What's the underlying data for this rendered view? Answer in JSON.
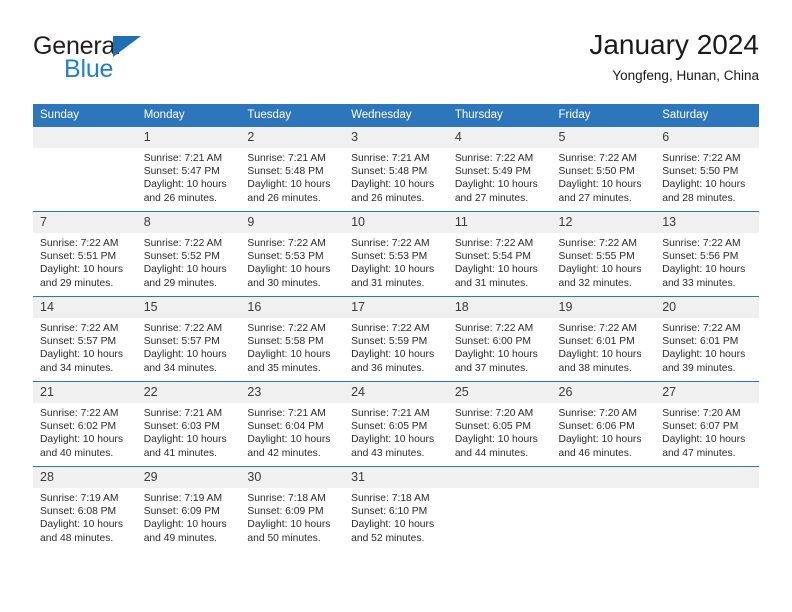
{
  "brand": {
    "name_top": "General",
    "name_bottom": "Blue",
    "triangle_color": "#1f6fb5",
    "blue_color": "#1f7fd0"
  },
  "header": {
    "title": "January 2024",
    "subtitle": "Yongfeng, Hunan, China"
  },
  "theme": {
    "header_bg": "#2e76bc",
    "daynum_bg": "#f0f0f0",
    "row_border": "#2e76bc",
    "text": "#2b2b2b"
  },
  "weekdays": [
    "Sunday",
    "Monday",
    "Tuesday",
    "Wednesday",
    "Thursday",
    "Friday",
    "Saturday"
  ],
  "labels": {
    "sunrise_prefix": "Sunrise:",
    "sunset_prefix": "Sunset:",
    "daylight_prefix": "Daylight:"
  },
  "weeks": [
    [
      {
        "day": "",
        "blank": true,
        "line1": "",
        "line2": "",
        "line3": "",
        "line4": ""
      },
      {
        "day": "1",
        "line1": "Sunrise: 7:21 AM",
        "line2": "Sunset: 5:47 PM",
        "line3": "Daylight: 10 hours",
        "line4": "and 26 minutes."
      },
      {
        "day": "2",
        "line1": "Sunrise: 7:21 AM",
        "line2": "Sunset: 5:48 PM",
        "line3": "Daylight: 10 hours",
        "line4": "and 26 minutes."
      },
      {
        "day": "3",
        "line1": "Sunrise: 7:21 AM",
        "line2": "Sunset: 5:48 PM",
        "line3": "Daylight: 10 hours",
        "line4": "and 26 minutes."
      },
      {
        "day": "4",
        "line1": "Sunrise: 7:22 AM",
        "line2": "Sunset: 5:49 PM",
        "line3": "Daylight: 10 hours",
        "line4": "and 27 minutes."
      },
      {
        "day": "5",
        "line1": "Sunrise: 7:22 AM",
        "line2": "Sunset: 5:50 PM",
        "line3": "Daylight: 10 hours",
        "line4": "and 27 minutes."
      },
      {
        "day": "6",
        "line1": "Sunrise: 7:22 AM",
        "line2": "Sunset: 5:50 PM",
        "line3": "Daylight: 10 hours",
        "line4": "and 28 minutes."
      }
    ],
    [
      {
        "day": "7",
        "line1": "Sunrise: 7:22 AM",
        "line2": "Sunset: 5:51 PM",
        "line3": "Daylight: 10 hours",
        "line4": "and 29 minutes."
      },
      {
        "day": "8",
        "line1": "Sunrise: 7:22 AM",
        "line2": "Sunset: 5:52 PM",
        "line3": "Daylight: 10 hours",
        "line4": "and 29 minutes."
      },
      {
        "day": "9",
        "line1": "Sunrise: 7:22 AM",
        "line2": "Sunset: 5:53 PM",
        "line3": "Daylight: 10 hours",
        "line4": "and 30 minutes."
      },
      {
        "day": "10",
        "line1": "Sunrise: 7:22 AM",
        "line2": "Sunset: 5:53 PM",
        "line3": "Daylight: 10 hours",
        "line4": "and 31 minutes."
      },
      {
        "day": "11",
        "line1": "Sunrise: 7:22 AM",
        "line2": "Sunset: 5:54 PM",
        "line3": "Daylight: 10 hours",
        "line4": "and 31 minutes."
      },
      {
        "day": "12",
        "line1": "Sunrise: 7:22 AM",
        "line2": "Sunset: 5:55 PM",
        "line3": "Daylight: 10 hours",
        "line4": "and 32 minutes."
      },
      {
        "day": "13",
        "line1": "Sunrise: 7:22 AM",
        "line2": "Sunset: 5:56 PM",
        "line3": "Daylight: 10 hours",
        "line4": "and 33 minutes."
      }
    ],
    [
      {
        "day": "14",
        "line1": "Sunrise: 7:22 AM",
        "line2": "Sunset: 5:57 PM",
        "line3": "Daylight: 10 hours",
        "line4": "and 34 minutes."
      },
      {
        "day": "15",
        "line1": "Sunrise: 7:22 AM",
        "line2": "Sunset: 5:57 PM",
        "line3": "Daylight: 10 hours",
        "line4": "and 34 minutes."
      },
      {
        "day": "16",
        "line1": "Sunrise: 7:22 AM",
        "line2": "Sunset: 5:58 PM",
        "line3": "Daylight: 10 hours",
        "line4": "and 35 minutes."
      },
      {
        "day": "17",
        "line1": "Sunrise: 7:22 AM",
        "line2": "Sunset: 5:59 PM",
        "line3": "Daylight: 10 hours",
        "line4": "and 36 minutes."
      },
      {
        "day": "18",
        "line1": "Sunrise: 7:22 AM",
        "line2": "Sunset: 6:00 PM",
        "line3": "Daylight: 10 hours",
        "line4": "and 37 minutes."
      },
      {
        "day": "19",
        "line1": "Sunrise: 7:22 AM",
        "line2": "Sunset: 6:01 PM",
        "line3": "Daylight: 10 hours",
        "line4": "and 38 minutes."
      },
      {
        "day": "20",
        "line1": "Sunrise: 7:22 AM",
        "line2": "Sunset: 6:01 PM",
        "line3": "Daylight: 10 hours",
        "line4": "and 39 minutes."
      }
    ],
    [
      {
        "day": "21",
        "line1": "Sunrise: 7:22 AM",
        "line2": "Sunset: 6:02 PM",
        "line3": "Daylight: 10 hours",
        "line4": "and 40 minutes."
      },
      {
        "day": "22",
        "line1": "Sunrise: 7:21 AM",
        "line2": "Sunset: 6:03 PM",
        "line3": "Daylight: 10 hours",
        "line4": "and 41 minutes."
      },
      {
        "day": "23",
        "line1": "Sunrise: 7:21 AM",
        "line2": "Sunset: 6:04 PM",
        "line3": "Daylight: 10 hours",
        "line4": "and 42 minutes."
      },
      {
        "day": "24",
        "line1": "Sunrise: 7:21 AM",
        "line2": "Sunset: 6:05 PM",
        "line3": "Daylight: 10 hours",
        "line4": "and 43 minutes."
      },
      {
        "day": "25",
        "line1": "Sunrise: 7:20 AM",
        "line2": "Sunset: 6:05 PM",
        "line3": "Daylight: 10 hours",
        "line4": "and 44 minutes."
      },
      {
        "day": "26",
        "line1": "Sunrise: 7:20 AM",
        "line2": "Sunset: 6:06 PM",
        "line3": "Daylight: 10 hours",
        "line4": "and 46 minutes."
      },
      {
        "day": "27",
        "line1": "Sunrise: 7:20 AM",
        "line2": "Sunset: 6:07 PM",
        "line3": "Daylight: 10 hours",
        "line4": "and 47 minutes."
      }
    ],
    [
      {
        "day": "28",
        "line1": "Sunrise: 7:19 AM",
        "line2": "Sunset: 6:08 PM",
        "line3": "Daylight: 10 hours",
        "line4": "and 48 minutes."
      },
      {
        "day": "29",
        "line1": "Sunrise: 7:19 AM",
        "line2": "Sunset: 6:09 PM",
        "line3": "Daylight: 10 hours",
        "line4": "and 49 minutes."
      },
      {
        "day": "30",
        "line1": "Sunrise: 7:18 AM",
        "line2": "Sunset: 6:09 PM",
        "line3": "Daylight: 10 hours",
        "line4": "and 50 minutes."
      },
      {
        "day": "31",
        "line1": "Sunrise: 7:18 AM",
        "line2": "Sunset: 6:10 PM",
        "line3": "Daylight: 10 hours",
        "line4": "and 52 minutes."
      },
      {
        "day": "",
        "blank": true,
        "line1": "",
        "line2": "",
        "line3": "",
        "line4": ""
      },
      {
        "day": "",
        "blank": true,
        "line1": "",
        "line2": "",
        "line3": "",
        "line4": ""
      },
      {
        "day": "",
        "blank": true,
        "line1": "",
        "line2": "",
        "line3": "",
        "line4": ""
      }
    ]
  ]
}
